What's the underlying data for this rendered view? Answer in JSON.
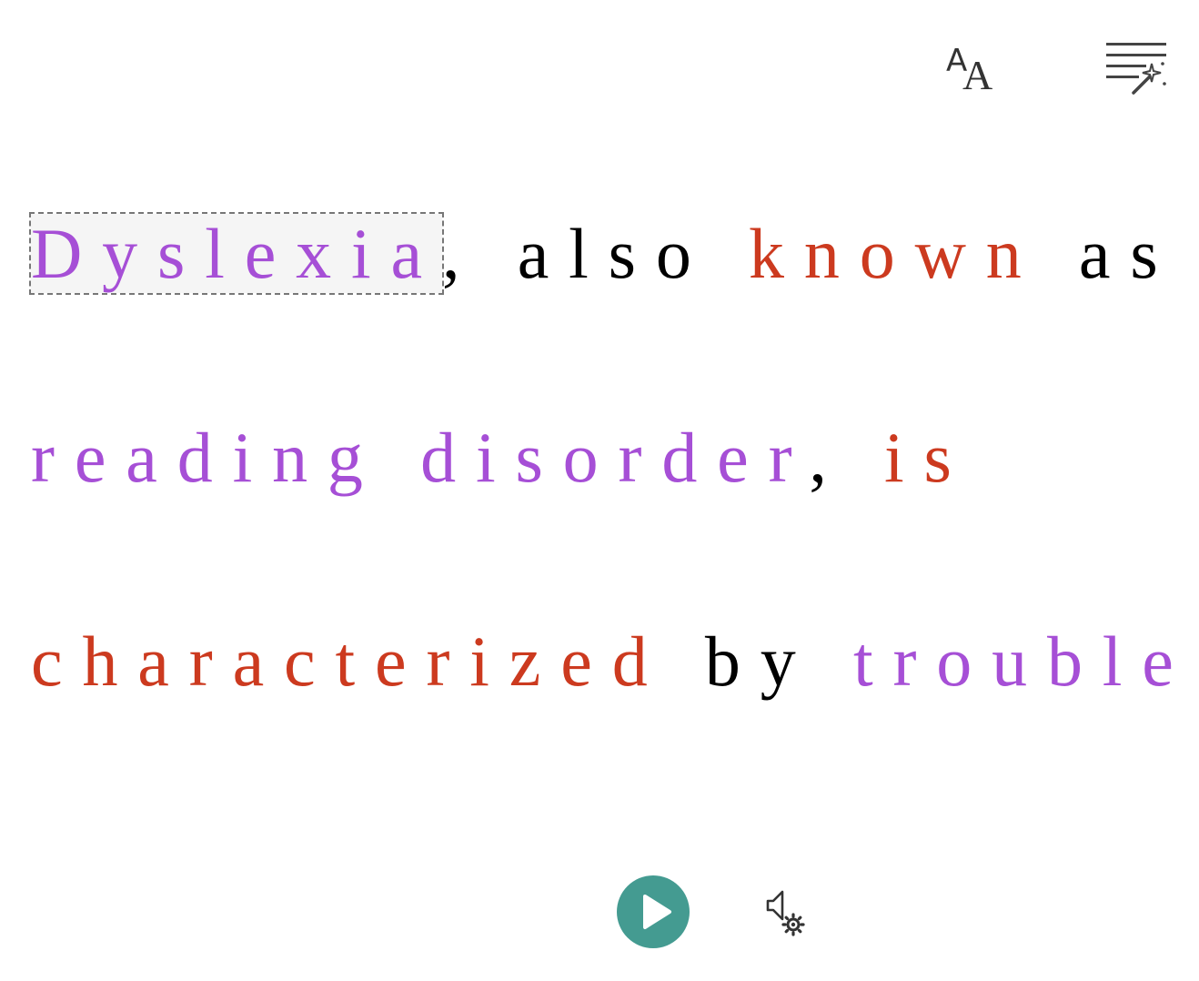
{
  "toolbar": {
    "text_options_icon": "text-size-icon",
    "grammar_options_icon": "magic-wand-lines-icon"
  },
  "reading": {
    "lines": [
      [
        {
          "text": "Dyslexia",
          "color": "purple",
          "selected": true
        },
        {
          "text": ",",
          "color": "black"
        },
        {
          "text": "also",
          "color": "black"
        },
        {
          "text": "known",
          "color": "red"
        },
        {
          "text": "as",
          "color": "black"
        }
      ],
      [
        {
          "text": "reading",
          "color": "purple"
        },
        {
          "text": "disorder",
          "color": "purple"
        },
        {
          "text": ",",
          "color": "black"
        },
        {
          "text": "is",
          "color": "red"
        }
      ],
      [
        {
          "text": "characterized",
          "color": "red"
        },
        {
          "text": "by",
          "color": "black"
        },
        {
          "text": "trouble",
          "color": "purple"
        }
      ]
    ],
    "colors": {
      "purple": "#a64fd6",
      "red": "#cc3a1f",
      "black": "#000000",
      "play_button": "#449b91"
    }
  },
  "controls": {
    "play_icon": "play-icon",
    "voice_settings_icon": "speaker-gear-icon"
  }
}
